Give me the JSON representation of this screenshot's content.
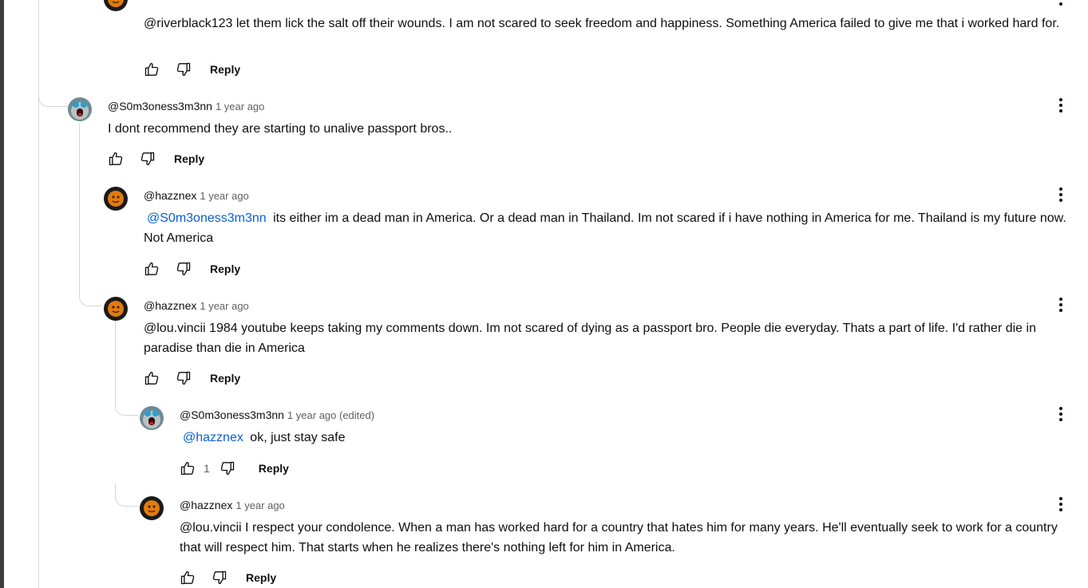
{
  "colors": {
    "mention": "#065fd4",
    "meta": "#606060",
    "text": "#0f0f0f",
    "thread_line": "#d6d6d6"
  },
  "icons": {
    "like": "thumbs-up-icon",
    "dislike": "thumbs-down-icon",
    "menu": "more-vert-icon"
  },
  "comments": [
    {
      "text": "@riverblack123  let them lick the salt off their wounds. I am not scared to seek freedom and happiness. Something America failed to give me that i worked hard for.",
      "reply_label": "Reply"
    },
    {
      "author": "@S0m3oness3m3nn",
      "time": "1 year ago",
      "text": "I dont recommend they are starting to unalive passport bros..",
      "reply_label": "Reply"
    },
    {
      "author": "@hazznex",
      "time": "1 year ago",
      "mention": "@S0m3oness3m3nn",
      "text": "its either im a dead man in America. Or a dead man in Thailand. Im not scared if i have nothing in America for me. Thailand is my future now. Not America",
      "reply_label": "Reply"
    },
    {
      "author": "@hazznex",
      "time": "1 year ago",
      "text": "@lou.vincii  1984 youtube keeps taking my comments down. Im not scared of dying as a passport bro. People die everyday. Thats a part of life. I'd rather die in paradise than die in America",
      "reply_label": "Reply"
    },
    {
      "author": "@S0m3oness3m3nn",
      "time": "1 year ago (edited)",
      "mention": "@hazznex",
      "text": "ok, just stay safe",
      "likes": "1",
      "reply_label": "Reply"
    },
    {
      "author": "@hazznex",
      "time": "1 year ago",
      "text": "@lou.vincii  I respect your condolence. When a man has worked hard for a country that hates him for many years. He'll eventually seek to work for a country that will respect him. That starts when he realizes there's nothing left for him in America.",
      "reply_label": "Reply"
    }
  ]
}
